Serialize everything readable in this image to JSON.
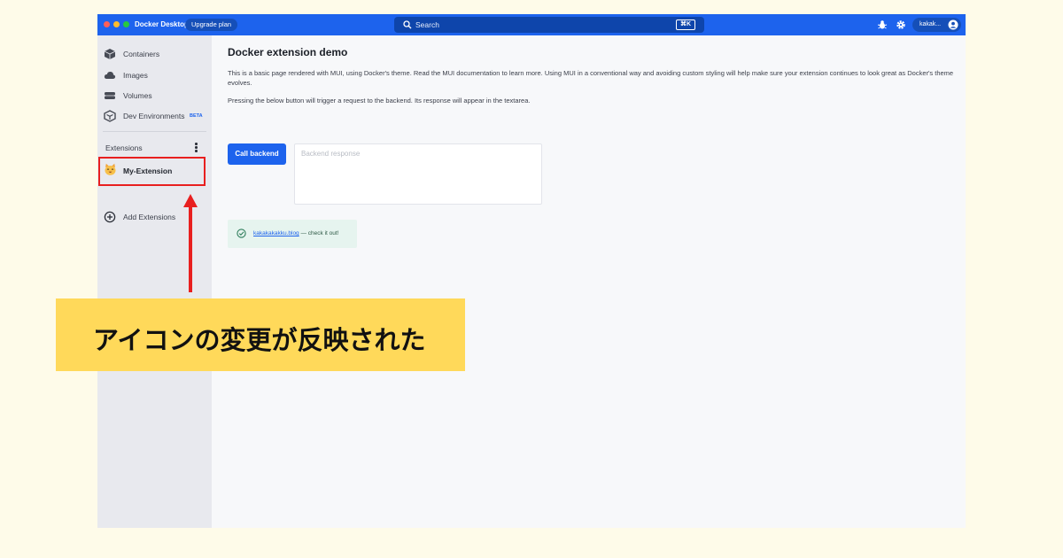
{
  "titlebar": {
    "app_title": "Docker Desktop",
    "upgrade_label": "Upgrade plan",
    "search_placeholder": "Search",
    "search_shortcut": "⌘K",
    "user_name": "kakak..."
  },
  "sidebar": {
    "items": [
      {
        "label": "Containers",
        "icon": "container-icon"
      },
      {
        "label": "Images",
        "icon": "cloud-icon"
      },
      {
        "label": "Volumes",
        "icon": "volume-icon"
      },
      {
        "label": "Dev Environments",
        "icon": "dev-env-icon",
        "badge": "BETA"
      }
    ],
    "extensions_header": "Extensions",
    "my_extension_label": "My-Extension",
    "add_extensions_label": "Add Extensions"
  },
  "main": {
    "title": "Docker extension demo",
    "para1": "This is a basic page rendered with MUI, using Docker's theme. Read the MUI documentation to learn more. Using MUI in a conventional way and avoiding custom styling will help make sure your extension continues to look great as Docker's theme evolves.",
    "para2": "Pressing the below button will trigger a request to the backend. Its response will appear in the textarea.",
    "call_button_label": "Call backend",
    "response_placeholder": "Backend response",
    "alert_link": "kakakakakku.blog",
    "alert_suffix": " — check it out!"
  },
  "annotation": {
    "banner_text": "アイコンの変更が反映された"
  },
  "colors": {
    "brand_blue": "#1d63ed",
    "annotation_red": "#e81f1f",
    "banner_yellow": "#ffd95a",
    "page_background": "#fefbe9"
  }
}
